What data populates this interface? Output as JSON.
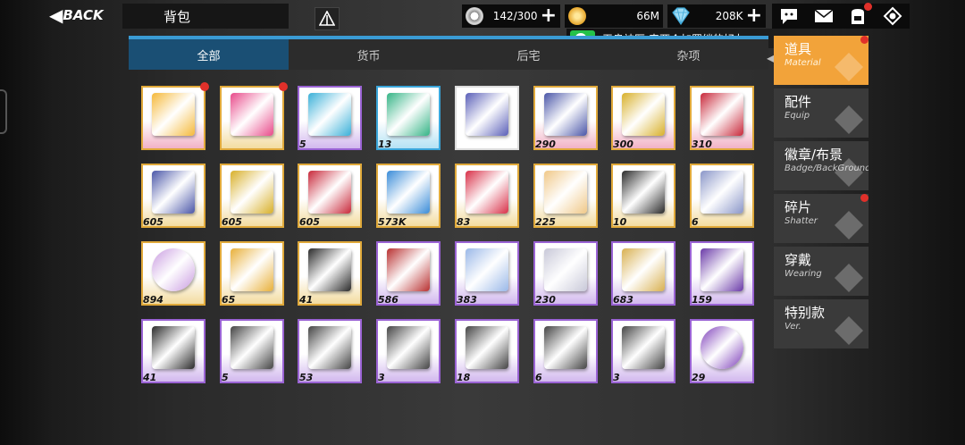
{
  "header": {
    "back_label": "BACK",
    "title": "背包"
  },
  "resources": [
    {
      "icon": "gear-coin-icon",
      "value": "142/300"
    },
    {
      "icon": "gold-coin-icon",
      "value": "66M"
    },
    {
      "icon": "diamond-icon",
      "value": "208K"
    }
  ],
  "top_icons": [
    "chat-icon",
    "mail-icon",
    "backpack-icon",
    "settings-icon"
  ],
  "notification": {
    "message": "无良神医:来两个加羁绊的好友"
  },
  "tabs": [
    {
      "label": "全部",
      "active": true
    },
    {
      "label": "货币",
      "active": false
    },
    {
      "label": "后宅",
      "active": false
    },
    {
      "label": "杂项",
      "active": false
    }
  ],
  "categories": [
    {
      "zh": "道具",
      "en": "Material",
      "active": true,
      "dot": true
    },
    {
      "zh": "配件",
      "en": "Equip",
      "active": false,
      "dot": false
    },
    {
      "zh": "徽章/布景",
      "en": "Badge/BackGround",
      "active": false,
      "dot": false
    },
    {
      "zh": "碎片",
      "en": "Shatter",
      "active": false,
      "dot": true
    },
    {
      "zh": "穿戴",
      "en": "Wearing",
      "active": false,
      "dot": false
    },
    {
      "zh": "特别款",
      "en": "Ver.",
      "active": false,
      "dot": false
    }
  ],
  "items": [
    {
      "rarity": "pink",
      "qty": "",
      "dot": true,
      "icon": "ticket-pack-icon",
      "color": "#f5b93a"
    },
    {
      "rarity": "gold",
      "qty": "",
      "dot": true,
      "icon": "pink-ticket-icon",
      "color": "#e84a8a"
    },
    {
      "rarity": "purple",
      "qty": "5",
      "dot": false,
      "icon": "blue-box-icon",
      "color": "#3ab0d8"
    },
    {
      "rarity": "blue",
      "qty": "13",
      "dot": false,
      "icon": "green-box-icon",
      "color": "#35b486"
    },
    {
      "rarity": "white",
      "qty": "",
      "dot": false,
      "icon": "card-icon",
      "color": "#5a5fb8"
    },
    {
      "rarity": "pink",
      "qty": "290",
      "dot": false,
      "icon": "beta-blue-ticket-icon",
      "color": "#4a56a8"
    },
    {
      "rarity": "pink",
      "qty": "300",
      "dot": false,
      "icon": "beta-gold-ticket-icon",
      "color": "#d8b02a"
    },
    {
      "rarity": "pink",
      "qty": "310",
      "dot": false,
      "icon": "beta-red-ticket-icon",
      "color": "#c8283a"
    },
    {
      "rarity": "gold",
      "qty": "605",
      "dot": false,
      "icon": "alpha-blue-ticket-icon",
      "color": "#4a56a8"
    },
    {
      "rarity": "gold",
      "qty": "605",
      "dot": false,
      "icon": "alpha-gold-ticket-icon",
      "color": "#d8b02a"
    },
    {
      "rarity": "gold",
      "qty": "605",
      "dot": false,
      "icon": "alpha-red-ticket-icon",
      "color": "#c8283a"
    },
    {
      "rarity": "gold",
      "qty": "573K",
      "dot": false,
      "icon": "feather-icon",
      "color": "#3a8cd8"
    },
    {
      "rarity": "gold",
      "qty": "83",
      "dot": false,
      "icon": "red-ticket-icon",
      "color": "#d83048"
    },
    {
      "rarity": "gold",
      "qty": "225",
      "dot": false,
      "icon": "character-icon",
      "color": "#f0c888"
    },
    {
      "rarity": "gold",
      "qty": "10",
      "dot": false,
      "icon": "badge-gold-icon",
      "color": "#2a2a2a"
    },
    {
      "rarity": "gold",
      "qty": "6",
      "dot": false,
      "icon": "pen-icon",
      "color": "#8a96c8"
    },
    {
      "rarity": "gold",
      "qty": "894",
      "dot": false,
      "icon": "orb-icon",
      "color": "#c89ae0"
    },
    {
      "rarity": "gold",
      "qty": "65",
      "dot": false,
      "icon": "star-icon",
      "color": "#e8b03a"
    },
    {
      "rarity": "gold",
      "qty": "41",
      "dot": false,
      "icon": "black-card-icon",
      "color": "#2a2a2a"
    },
    {
      "rarity": "purple",
      "qty": "586",
      "dot": false,
      "icon": "canister-icon",
      "color": "#b83030"
    },
    {
      "rarity": "purple",
      "qty": "383",
      "dot": false,
      "icon": "bottle-icon",
      "color": "#9ab8e8"
    },
    {
      "rarity": "purple",
      "qty": "230",
      "dot": false,
      "icon": "tube-icon",
      "color": "#c8c8d8"
    },
    {
      "rarity": "purple",
      "qty": "683",
      "dot": false,
      "icon": "tube-gold-icon",
      "color": "#d8b050"
    },
    {
      "rarity": "purple",
      "qty": "159",
      "dot": false,
      "icon": "badge-purple-icon",
      "color": "#6a3aa8"
    },
    {
      "rarity": "purple",
      "qty": "41",
      "dot": false,
      "icon": "magazine-icon",
      "color": "#2a2a2a"
    },
    {
      "rarity": "purple",
      "qty": "5",
      "dot": false,
      "icon": "shoes-pack-icon",
      "color": "#444"
    },
    {
      "rarity": "purple",
      "qty": "53",
      "dot": false,
      "icon": "gloves-pack-icon",
      "color": "#444"
    },
    {
      "rarity": "purple",
      "qty": "3",
      "dot": false,
      "icon": "other-pack-icon",
      "color": "#444"
    },
    {
      "rarity": "purple",
      "qty": "18",
      "dot": false,
      "icon": "pants-pack-icon",
      "color": "#444"
    },
    {
      "rarity": "purple",
      "qty": "6",
      "dot": false,
      "icon": "clothes-pack-icon",
      "color": "#444"
    },
    {
      "rarity": "purple",
      "qty": "3",
      "dot": false,
      "icon": "hats-pack-icon",
      "color": "#444"
    },
    {
      "rarity": "purple",
      "qty": "29",
      "dot": false,
      "icon": "button-icon",
      "color": "#7a3ab8"
    }
  ]
}
